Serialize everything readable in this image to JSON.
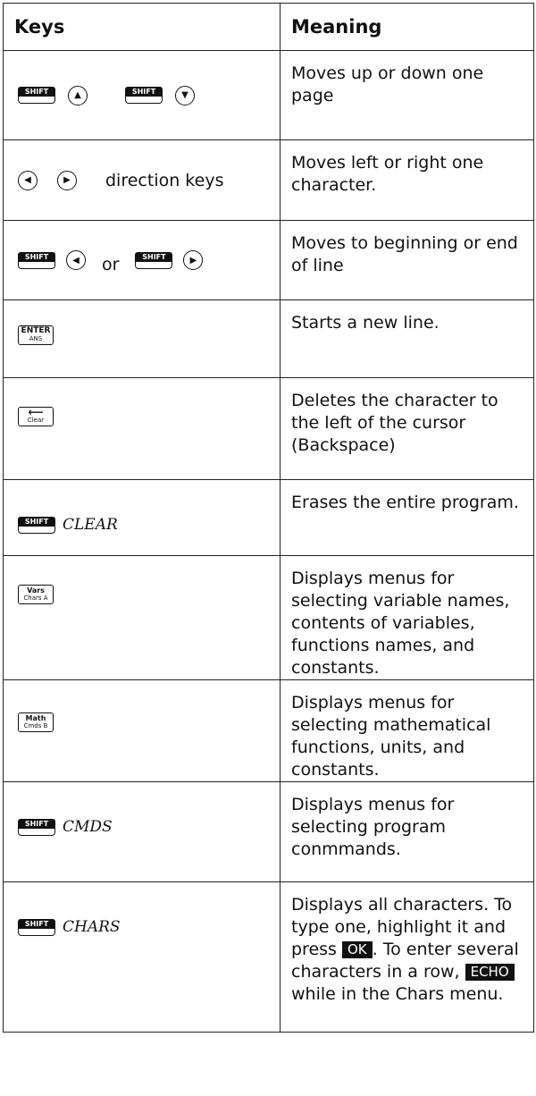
{
  "header": {
    "keys": "Keys",
    "meaning": "Meaning"
  },
  "key_labels": {
    "shift": "SHIFT",
    "enter_top": "ENTER",
    "enter_bottom": "ANS",
    "clear_bottom": "Clear",
    "vars_top": "Vars",
    "vars_bottom": "Chars   A",
    "math_top": "Math",
    "math_bottom": "Cmds   B"
  },
  "rows": [
    {
      "meaning": "Moves up or down one page"
    },
    {
      "key_text": "direction keys",
      "meaning": "Moves left or right one character."
    },
    {
      "key_text": "or",
      "meaning": "Moves to beginning or end of line"
    },
    {
      "meaning": "Starts a new line."
    },
    {
      "meaning": "Deletes the character to the left of the cursor (Backspace)"
    },
    {
      "key_text": "CLEAR",
      "meaning": "Erases the entire program."
    },
    {
      "meaning": "Displays menus for selecting variable names, contents of variables, functions names, and constants."
    },
    {
      "meaning": "Displays menus for selecting mathematical functions, units, and constants."
    },
    {
      "key_text": "CMDS",
      "meaning": "Displays menus for selecting program conmmands."
    },
    {
      "key_text": "CHARS",
      "meaning_parts": {
        "p1": "Displays all characters. To type one, highlight it and press ",
        "ok": "OK",
        "p2": ". To enter several characters in a row, ",
        "echo": "ECHO",
        "p3": " while in the Chars menu."
      }
    }
  ]
}
